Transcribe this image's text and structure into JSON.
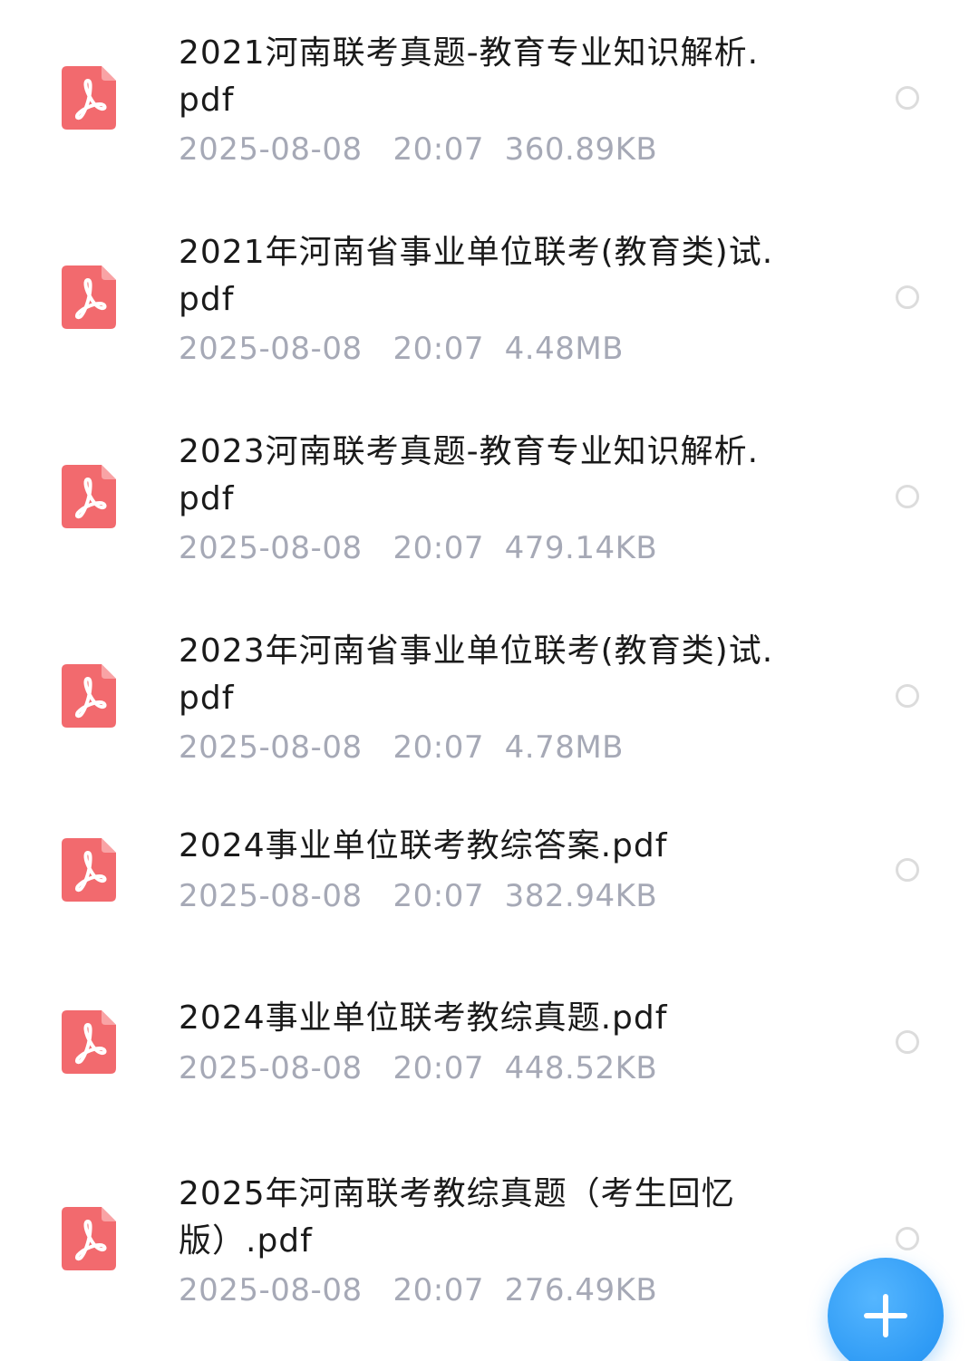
{
  "files": [
    {
      "title": "2021河南联考真题-教育专业知识解析.pdf",
      "date": "2025-08-08",
      "time": "20:07",
      "size": "360.89KB"
    },
    {
      "title": "2021年河南省事业单位联考(教育类)试.pdf",
      "date": "2025-08-08",
      "time": "20:07",
      "size": "4.48MB"
    },
    {
      "title": "2023河南联考真题-教育专业知识解析.pdf",
      "date": "2025-08-08",
      "time": "20:07",
      "size": "479.14KB"
    },
    {
      "title": "2023年河南省事业单位联考(教育类)试.pdf",
      "date": "2025-08-08",
      "time": "20:07",
      "size": "4.78MB"
    },
    {
      "title": "2024事业单位联考教综答案.pdf",
      "date": "2025-08-08",
      "time": "20:07",
      "size": "382.94KB"
    },
    {
      "title": "2024事业单位联考教综真题.pdf",
      "date": "2025-08-08",
      "time": "20:07",
      "size": "448.52KB"
    },
    {
      "title": "2025年河南联考教综真题（考生回忆版）.pdf",
      "date": "2025-08-08",
      "time": "20:07",
      "size": "276.49KB"
    }
  ],
  "icons": {
    "file_icon": "pdf-file-icon",
    "select_icon": "radio-circle-icon",
    "fab_icon": "plus-icon"
  },
  "colors": {
    "pdf_icon_bg": "#f26a6e",
    "fab_bg": "#2f9bf5",
    "meta_text": "#a6a9b6",
    "title_text": "#1a1a1a"
  }
}
